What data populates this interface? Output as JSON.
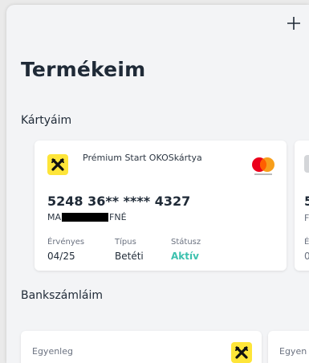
{
  "header": {
    "title": "Termékeim",
    "add_icon": "plus-icon"
  },
  "cards_section": {
    "label": "Kártyáim",
    "card": {
      "logo_icon": "raiffeisen-logo",
      "name": "Prémium Start OKOSkártya",
      "brand_icon": "mastercard-logo",
      "number": "5248 36** **** 4327",
      "holder_prefix": "MA",
      "holder_suffix": "FNÉ",
      "fields": [
        {
          "label": "Érvényes",
          "value": "04/25"
        },
        {
          "label": "Típus",
          "value": "Betéti"
        },
        {
          "label": "Státusz",
          "value": "Aktív"
        }
      ]
    },
    "peek_card": {
      "number_start": "5",
      "line2_start": "F",
      "label_start": "É",
      "value_start": "0"
    }
  },
  "accounts_section": {
    "label": "Bankszámláim",
    "accounts": [
      {
        "label": "Egyenleg",
        "logo_icon": "raiffeisen-logo"
      },
      {
        "label": "Egyen"
      }
    ]
  },
  "colors": {
    "accent_yellow": "#fee539",
    "status_active": "#3cc1ae",
    "text_dark": "#1f2a37"
  }
}
